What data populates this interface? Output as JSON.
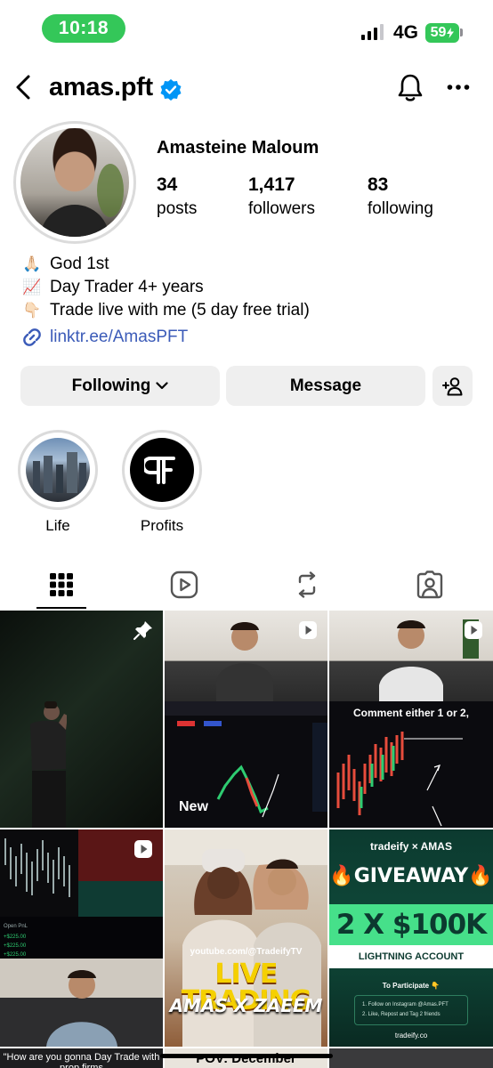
{
  "status": {
    "time": "10:18",
    "network": "4G",
    "battery": "59"
  },
  "header": {
    "username": "amas.pft"
  },
  "profile": {
    "full_name": "Amasteine Maloum",
    "stats": [
      {
        "value": "34",
        "label": "posts"
      },
      {
        "value": "1,417",
        "label": "followers"
      },
      {
        "value": "83",
        "label": "following"
      }
    ],
    "bio": [
      {
        "emoji": "🙏🏻",
        "text": "God 1st"
      },
      {
        "emoji": "📈",
        "text": "Day Trader 4+ years"
      },
      {
        "emoji": "👇🏻",
        "text": "Trade live with me (5 day free trial)"
      }
    ],
    "link": "linktr.ee/AmasPFT"
  },
  "actions": {
    "following": "Following",
    "message": "Message"
  },
  "highlights": [
    {
      "label": "Life"
    },
    {
      "label": "Profits"
    }
  ],
  "tabs": [
    "grid",
    "reels",
    "reposts",
    "tagged"
  ],
  "grid": {
    "t2_overlay": "New",
    "t3_caption": "Comment either 1 or 2,",
    "t5_top": "youtube.com/@TradeifyTV",
    "t5_main": "LIVE TRADING",
    "t5_sub": "AMAS X ZAEEM",
    "t6_brand": "tradeify  ×  AMAS",
    "t6_giveaway": "🔥GIVEAWAY🔥",
    "t6_amount": "2 X $100K",
    "t6_account": "LIGHTNING ACCOUNT",
    "t6_participate": "To Participate 👇",
    "t6_step1": "1. Follow on Instagram @Amas.PFT",
    "t6_step2": "2. Like, Repost and Tag 2 friends",
    "t6_site": "tradeify.co",
    "t7_caption": "\"How are you gonna Day Trade with prop firms",
    "t8_caption": "POV: December"
  },
  "colors": {
    "accent_green": "#34c759",
    "link_blue": "#3b5bb8",
    "verified_blue": "#0095f6",
    "button_gray": "#efefef"
  }
}
